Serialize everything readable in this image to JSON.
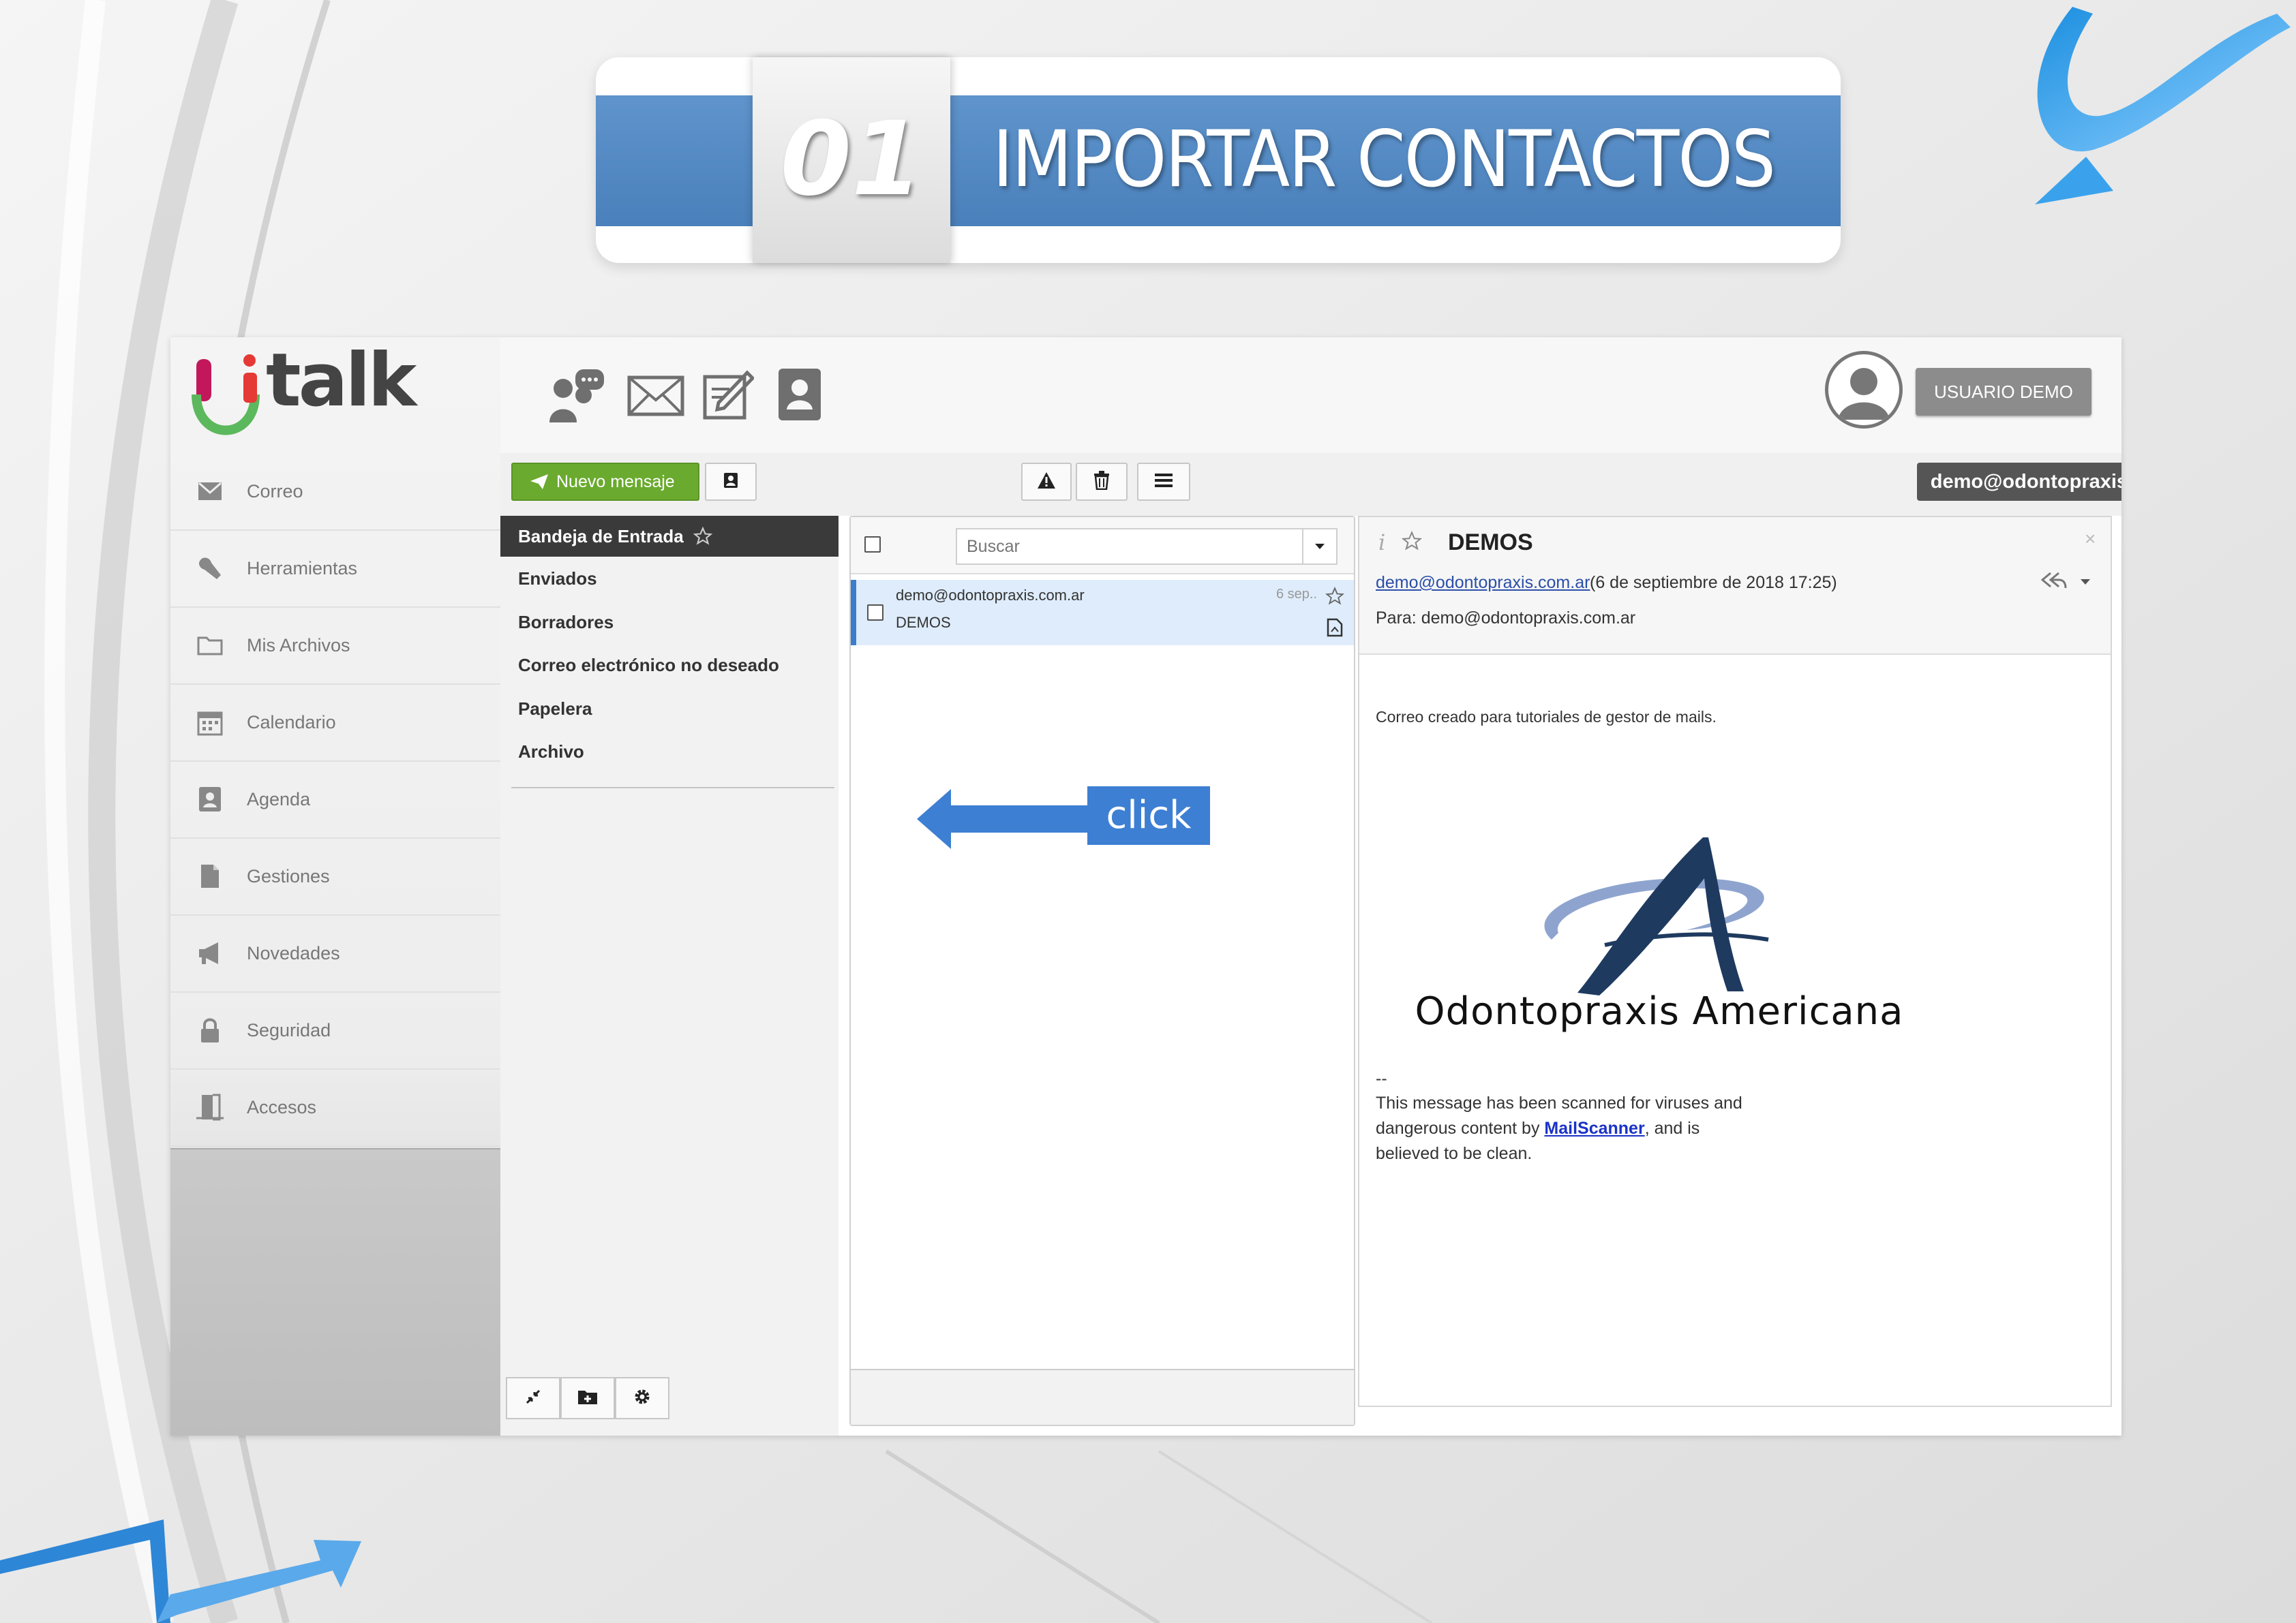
{
  "banner": {
    "number": "01",
    "title": "IMPORTAR CONTACTOS"
  },
  "app": {
    "logo_text": "talk",
    "sidebar": {
      "items": [
        {
          "label": "Correo",
          "icon": "envelope-icon"
        },
        {
          "label": "Herramientas",
          "icon": "wrench-icon"
        },
        {
          "label": "Mis Archivos",
          "icon": "folder-icon"
        },
        {
          "label": "Calendario",
          "icon": "calendar-icon"
        },
        {
          "label": "Agenda",
          "icon": "contact-book-icon"
        },
        {
          "label": "Gestiones",
          "icon": "document-icon"
        },
        {
          "label": "Novedades",
          "icon": "megaphone-icon"
        },
        {
          "label": "Seguridad",
          "icon": "lock-icon"
        },
        {
          "label": "Accesos",
          "icon": "door-icon"
        }
      ]
    },
    "topbar": {
      "icons": [
        "chat-icon",
        "mail-icon",
        "compose-icon",
        "contacts-icon"
      ],
      "user_label": "USUARIO DEMO"
    },
    "toolbar": {
      "new_message": "Nuevo mensaje",
      "click_label": "click",
      "account_email": "demo@odontopraxis.com.ar"
    },
    "folders": [
      {
        "label": "Bandeja de Entrada"
      },
      {
        "label": "Enviados"
      },
      {
        "label": "Borradores"
      },
      {
        "label": "Correo electrónico no deseado"
      },
      {
        "label": "Papelera"
      },
      {
        "label": "Archivo"
      }
    ],
    "message_list": {
      "search_placeholder": "Buscar",
      "messages": [
        {
          "from": "demo@odontopraxis.com.ar",
          "subject": "DEMOS",
          "date": "6 sep.."
        }
      ]
    },
    "reader": {
      "subject": "DEMOS",
      "from_link": "demo@odontopraxis.com.ar",
      "date": "(6 de septiembre de 2018 17:25)",
      "to": "Para: demo@odontopraxis.com.ar",
      "body": "Correo creado para tutoriales de gestor de mails.",
      "logo_text": "Odontopraxis Americana",
      "sig_dash": "--",
      "scan_line1": "This message has been scanned for viruses and",
      "scan_line2_pre": "dangerous content by ",
      "scan_link": "MailScanner",
      "scan_line2_post": ", and is",
      "scan_line3": "believed to be clean."
    }
  },
  "colors": {
    "banner_blue": "#5b91c8",
    "accent_blue": "#3b7ecb",
    "new_message_green": "#6aaa2e",
    "logo_magenta": "#c2185b",
    "logo_green": "#5cb85c",
    "brand_navy": "#1f3a5f"
  }
}
